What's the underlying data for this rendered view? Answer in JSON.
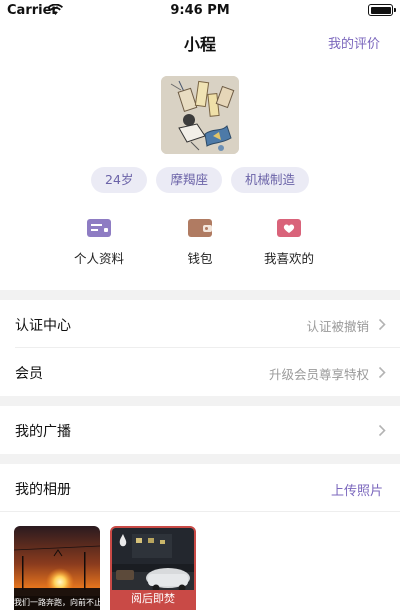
{
  "status_bar": {
    "carrier": "Carrier",
    "time": "9:46 PM"
  },
  "nav": {
    "title": "小程",
    "right_link": "我的评价"
  },
  "profile": {
    "tags": [
      "24岁",
      "摩羯座",
      "机械制造"
    ]
  },
  "quick_actions": [
    {
      "label": "个人资料",
      "icon": "profile-card-icon",
      "color": "#8e7cc3"
    },
    {
      "label": "钱包",
      "icon": "wallet-icon",
      "color": "#b07b62"
    },
    {
      "label": "我喜欢的",
      "icon": "heart-icon",
      "color": "#d9637a"
    }
  ],
  "menu": {
    "certification": {
      "label": "认证中心",
      "value": "认证被撤销"
    },
    "membership": {
      "label": "会员",
      "value": "升级会员尊享特权"
    },
    "broadcast": {
      "label": "我的广播"
    }
  },
  "album": {
    "title": "我的相册",
    "upload_label": "上传照片",
    "photos": [
      {
        "caption": "我们一路奔跑，向前不止"
      },
      {
        "caption": "阅后即焚"
      }
    ]
  },
  "colors": {
    "accent": "#7b67bd",
    "tag_bg": "#ebebf5",
    "burn_red": "#c94a46"
  }
}
